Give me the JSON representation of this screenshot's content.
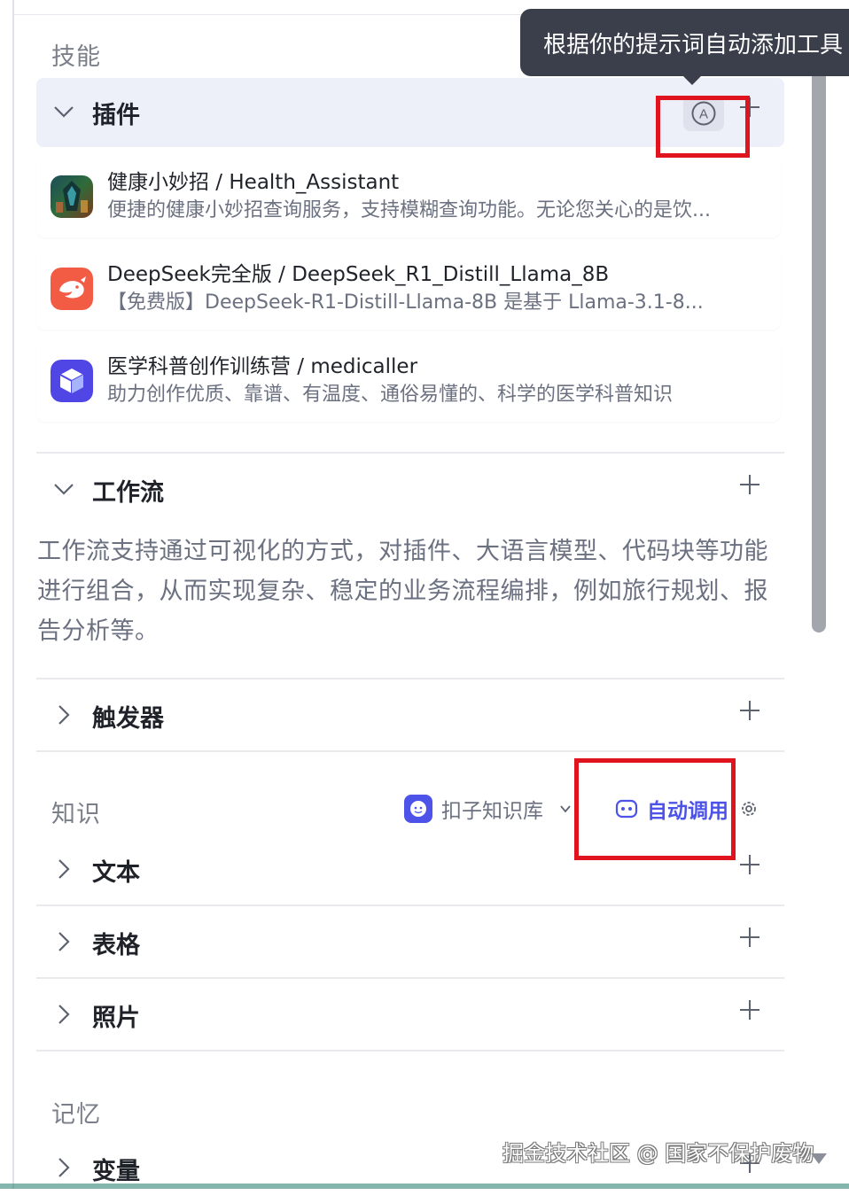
{
  "tooltip": {
    "text": "根据你的提示词自动添加工具"
  },
  "skills": {
    "label": "技能",
    "plugins": {
      "title": "插件",
      "auto_add_icon": "letter-a-circle-icon",
      "items": [
        {
          "name": "健康小妙招 / Health_Assistant",
          "desc": "便捷的健康小妙招查询服务，支持模糊查询功能。无论您关心的是饮...",
          "icon": "health-assistant-icon"
        },
        {
          "name": "DeepSeek完全版 / DeepSeek_R1_Distill_Llama_8B",
          "desc": "【免费版】DeepSeek-R1-Distill-Llama-8B 是基于 Llama-3.1-8...",
          "icon": "deepseek-whale-icon"
        },
        {
          "name": "医学科普创作训练营 / medicaller",
          "desc": "助力创作优质、靠谱、有温度、通俗易懂的、科学的医学科普知识",
          "icon": "cube-icon"
        }
      ]
    },
    "workflow": {
      "title": "工作流",
      "description": "工作流支持通过可视化的方式，对插件、大语言模型、代码块等功能进行组合，从而实现复杂、稳定的业务流程编排，例如旅行规划、报告分析等。"
    },
    "trigger": {
      "title": "触发器"
    }
  },
  "knowledge": {
    "label": "知识",
    "kb_selector": "扣子知识库",
    "auto_call": "自动调用",
    "items": [
      {
        "title": "文本"
      },
      {
        "title": "表格"
      },
      {
        "title": "照片"
      }
    ]
  },
  "memory": {
    "label": "记忆",
    "variable": {
      "title": "变量"
    }
  },
  "watermark": "掘金技术社区 @ 国家不保护废物",
  "colors": {
    "accent": "#4d53e8",
    "highlight_box": "#e0141e",
    "tooltip_bg": "#3a3f4b",
    "header_active_bg": "#eef0f9"
  }
}
